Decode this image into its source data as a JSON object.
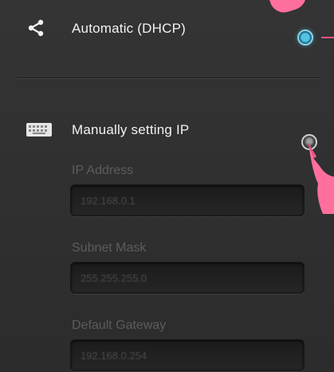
{
  "network": {
    "automatic": {
      "label": "Automatic (DHCP)",
      "icon": "share-icon",
      "selected": true
    },
    "manual": {
      "label": "Manually setting IP",
      "icon": "keyboard-icon",
      "selected": false,
      "fields": [
        {
          "label": "IP Address",
          "value": "192.168.0.1"
        },
        {
          "label": "Subnet Mask",
          "value": "255.255.255.0"
        },
        {
          "label": "Default Gateway",
          "value": "192.168.0.254"
        }
      ]
    }
  },
  "colors": {
    "background": "#2f2f2f",
    "selected_radio": "#53c3e3",
    "callout": "#ff6f9d"
  }
}
